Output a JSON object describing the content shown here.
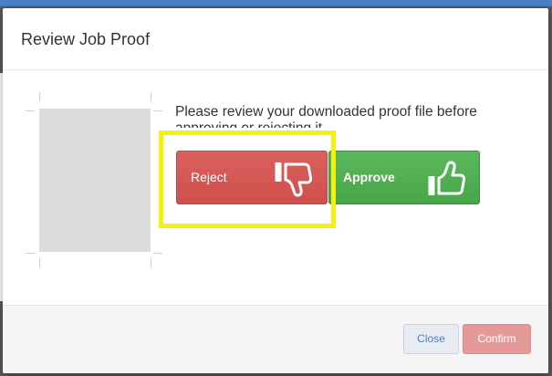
{
  "modal": {
    "title": "Review Job Proof",
    "instruction": "Please review your downloaded proof file before approving or rejecting it.",
    "reject_label": "Reject",
    "approve_label": "Approve",
    "close_label": "Close",
    "confirm_label": "Confirm"
  },
  "icons": {
    "reject": "thumbs-down-icon",
    "approve": "thumbs-up-icon"
  },
  "colors": {
    "reject": "#d9534f",
    "approve": "#5cb85c",
    "highlight": "#f2f20a",
    "confirm_disabled": "#e59a9a",
    "link": "#4a7fc1"
  }
}
